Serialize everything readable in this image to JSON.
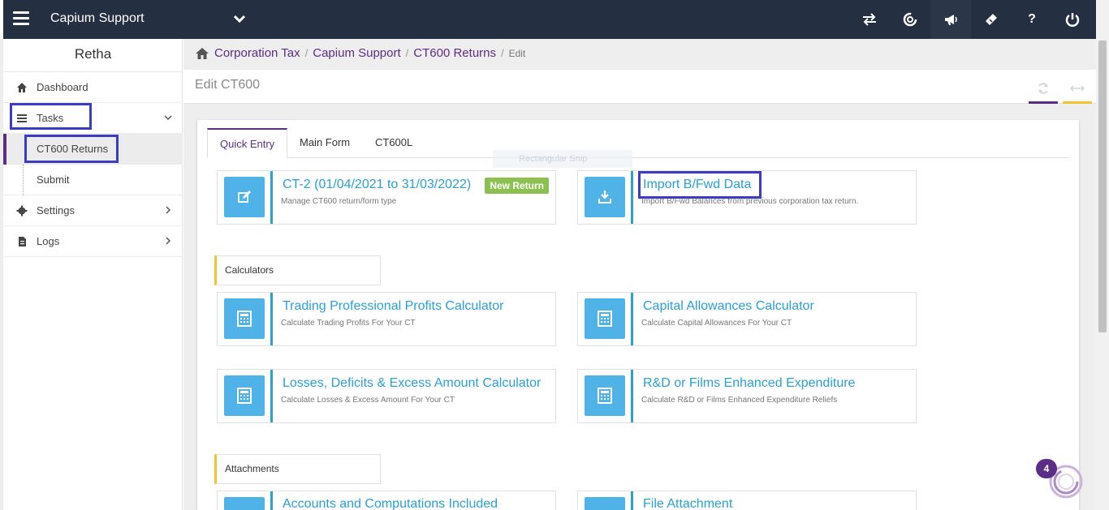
{
  "topbar": {
    "app_title": "Capium Support",
    "icons": [
      "transfer-icon",
      "capium-logo-icon",
      "megaphone-icon",
      "ticket-icon",
      "help-icon",
      "power-icon"
    ],
    "help_glyph": "?"
  },
  "sidebar": {
    "user_name": "Retha",
    "items": [
      {
        "label": "Dashboard"
      },
      {
        "label": "Tasks"
      },
      {
        "label": "CT600 Returns"
      },
      {
        "label": "Submit"
      },
      {
        "label": "Settings"
      },
      {
        "label": "Logs"
      }
    ]
  },
  "breadcrumb": {
    "items": [
      "Corporation Tax",
      "Capium Support",
      "CT600 Returns"
    ],
    "current": "Edit",
    "separator": "/"
  },
  "page": {
    "title": "Edit CT600"
  },
  "tabs": [
    {
      "label": "Quick Entry",
      "active": true
    },
    {
      "label": "Main Form",
      "active": false
    },
    {
      "label": "CT600L",
      "active": false
    }
  ],
  "overlay": {
    "snip_text": "Rectangular Snip"
  },
  "cards": {
    "ct2": {
      "title": "CT-2 (01/04/2021 to 31/03/2022)",
      "subtitle": "Manage CT600 return/form type",
      "badge": "New Return"
    },
    "import": {
      "title": "Import B/Fwd Data",
      "subtitle": "Import B/Fwd Balances from previous corporation tax return."
    },
    "trading": {
      "title": "Trading Professional Profits Calculator",
      "subtitle": "Calculate Trading Profits For Your CT"
    },
    "capital": {
      "title": "Capital Allowances Calculator",
      "subtitle": "Calculate Capital Allowances For Your CT"
    },
    "losses": {
      "title": "Losses, Deficits & Excess Amount Calculator",
      "subtitle": "Calculate Losses & Excess Amount For Your CT"
    },
    "rnd": {
      "title": "R&D or Films Enhanced Expenditure",
      "subtitle": "Calculate R&D or Films Enhanced Expenditure Reliefs"
    },
    "accounts": {
      "title": "Accounts and Computations Included",
      "subtitle": ""
    },
    "file": {
      "title": "File Attachment",
      "subtitle": ""
    }
  },
  "sections": {
    "calculators": "Calculators",
    "attachments": "Attachments"
  },
  "fab": {
    "count": "4"
  },
  "colors": {
    "topbar": "#243041",
    "accent_purple": "#5b2d86",
    "accent_yellow": "#f4c430",
    "icon_blue": "#4fb3e8",
    "title_blue": "#2a9fd6",
    "badge_green": "#8cc152",
    "highlight": "#3b3bc7"
  }
}
